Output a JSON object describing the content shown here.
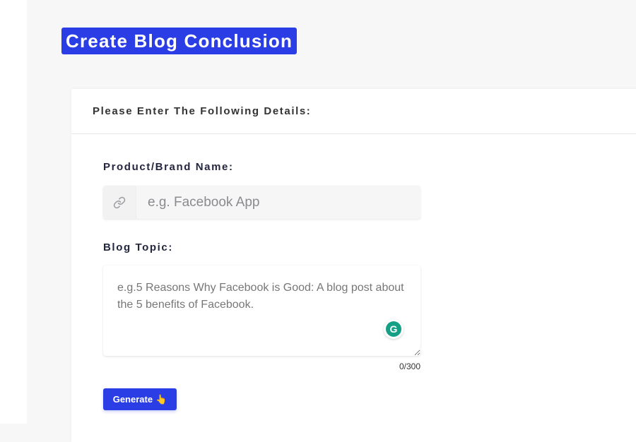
{
  "page": {
    "title": "Create Blog Conclusion"
  },
  "form": {
    "header": "Please Enter The Following Details:",
    "brand_label": "Product/Brand Name:",
    "brand_placeholder": "e.g. Facebook App",
    "brand_icon": "link-icon",
    "topic_label": "Blog Topic:",
    "topic_placeholder": "e.g.5 Reasons Why Facebook is Good: A blog post about the 5 benefits of Facebook.",
    "grammarly_letter": "G",
    "char_count": "0/300",
    "generate_label": "Generate",
    "generate_emoji": "👆"
  },
  "colors": {
    "accent": "#2b3ee6",
    "grammarly": "#15a085"
  }
}
